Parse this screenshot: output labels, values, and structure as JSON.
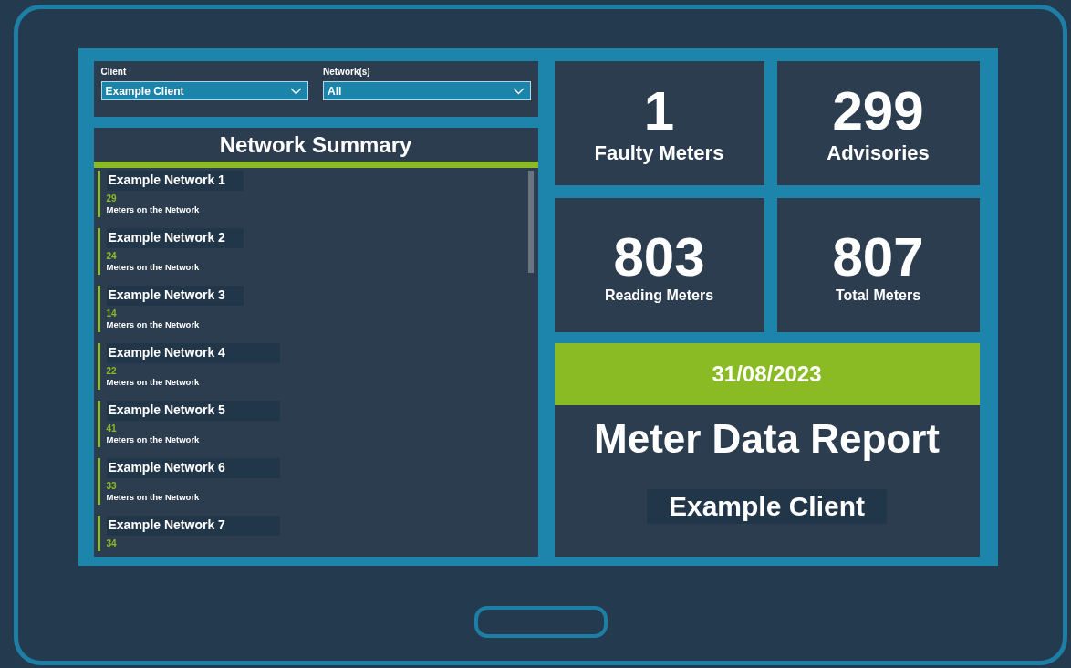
{
  "filters": [
    {
      "label": "Client",
      "value": "Example Client"
    },
    {
      "label": "Network(s)",
      "value": "All"
    }
  ],
  "network_summary": {
    "title": "Network Summary",
    "networks": [
      {
        "name": "Example Network 1",
        "count": "29",
        "caption": "Meters on the Network"
      },
      {
        "name": "Example Network 2",
        "count": "24",
        "caption": "Meters on the Network"
      },
      {
        "name": "Example Network 3",
        "count": "14",
        "caption": "Meters on the Network"
      },
      {
        "name": "Example Network 4",
        "count": "22",
        "caption": "Meters on the Network"
      },
      {
        "name": "Example Network 5",
        "count": "41",
        "caption": "Meters on the Network"
      },
      {
        "name": "Example Network 6",
        "count": "33",
        "caption": "Meters on the Network"
      },
      {
        "name": "Example Network 7",
        "count": "34"
      }
    ]
  },
  "kpis": [
    {
      "value": "1",
      "label": "Faulty Meters"
    },
    {
      "value": "299",
      "label": "Advisories"
    },
    {
      "value": "803",
      "label": "Reading Meters"
    },
    {
      "value": "807",
      "label": "Total Meters"
    }
  ],
  "report": {
    "date": "31/08/2023",
    "title": "Meter Data Report",
    "client": "Example Client"
  }
}
